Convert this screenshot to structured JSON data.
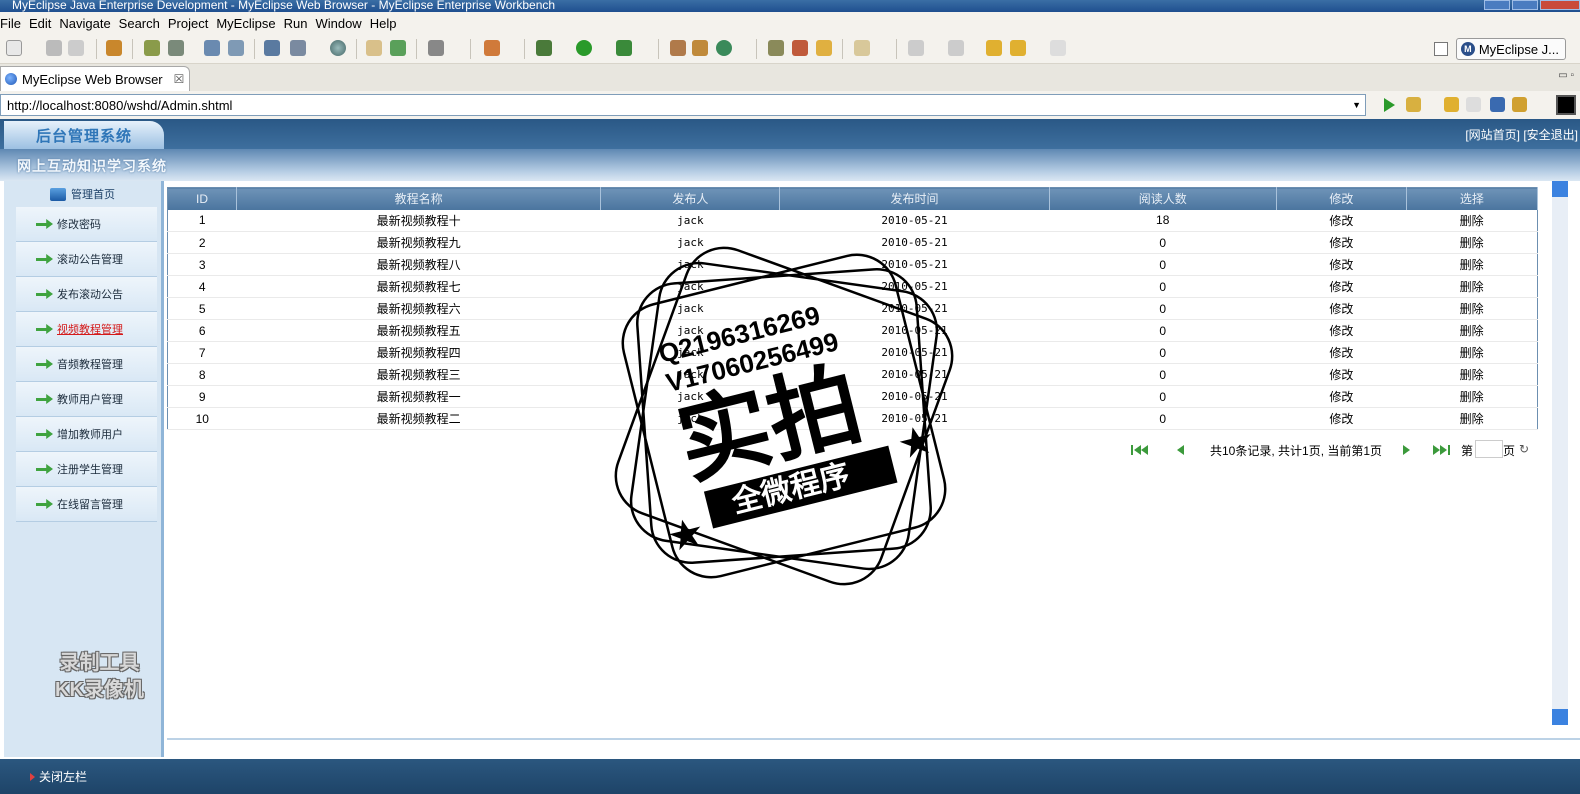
{
  "window": {
    "title": "MyEclipse Java Enterprise Development - MyEclipse Web Browser - MyEclipse Enterprise Workbench"
  },
  "menu": [
    "File",
    "Edit",
    "Navigate",
    "Search",
    "Project",
    "MyEclipse",
    "Run",
    "Window",
    "Help"
  ],
  "perspective": {
    "label": "MyEclipse J..."
  },
  "editor_tab": {
    "label": "MyEclipse Web Browser"
  },
  "address": {
    "url": "http://localhost:8080/wshd/Admin.shtml"
  },
  "app": {
    "logo": "后台管理系统",
    "links": [
      "[网站首页]",
      "[安全退出]"
    ],
    "subtitle": "网上互动知识学习系统",
    "sidebar_head": "管理首页",
    "sidebar_items": [
      "修改密码",
      "滚动公告管理",
      "发布滚动公告",
      "视频教程管理",
      "音频教程管理",
      "教师用户管理",
      "增加教师用户",
      "注册学生管理",
      "在线留言管理"
    ],
    "sidebar_active_index": 3,
    "footer_toggle": "关闭左栏"
  },
  "table": {
    "headers": [
      "ID",
      "教程名称",
      "发布人",
      "发布时间",
      "阅读人数",
      "修改",
      "选择"
    ],
    "rows": [
      [
        "1",
        "最新视频教程十",
        "jack",
        "2010-05-21",
        "18",
        "修改",
        "删除"
      ],
      [
        "2",
        "最新视频教程九",
        "jack",
        "2010-05-21",
        "0",
        "修改",
        "删除"
      ],
      [
        "3",
        "最新视频教程八",
        "jack",
        "2010-05-21",
        "0",
        "修改",
        "删除"
      ],
      [
        "4",
        "最新视频教程七",
        "jack",
        "2010-05-21",
        "0",
        "修改",
        "删除"
      ],
      [
        "5",
        "最新视频教程六",
        "jack",
        "2010-05-21",
        "0",
        "修改",
        "删除"
      ],
      [
        "6",
        "最新视频教程五",
        "jack",
        "2010-05-21",
        "0",
        "修改",
        "删除"
      ],
      [
        "7",
        "最新视频教程四",
        "jack",
        "2010-05-21",
        "0",
        "修改",
        "删除"
      ],
      [
        "8",
        "最新视频教程三",
        "jack",
        "2010-05-21",
        "0",
        "修改",
        "删除"
      ],
      [
        "9",
        "最新视频教程一",
        "jack",
        "2010-05-21",
        "0",
        "修改",
        "删除"
      ],
      [
        "10",
        "最新视频教程二",
        "jack",
        "2010-05-21",
        "0",
        "修改",
        "删除"
      ]
    ]
  },
  "pager": {
    "info": "共10条记录, 共计1页, 当前第1页",
    "page_label_before": "第",
    "page_label_after": "页"
  },
  "watermarks": {
    "stamp_q": "Q2196316269",
    "stamp_v": "V17060256499",
    "stamp_main": "实拍",
    "stamp_banner": "全微程序",
    "recorder": [
      "录制工具",
      "KK录像机"
    ]
  },
  "colors": {
    "header_blue": "#2a5886",
    "table_header": "#4a749e",
    "sidebar_bg": "#d7e6f3",
    "active_link": "#d41a1a",
    "icon_green": "#3fa33f"
  }
}
